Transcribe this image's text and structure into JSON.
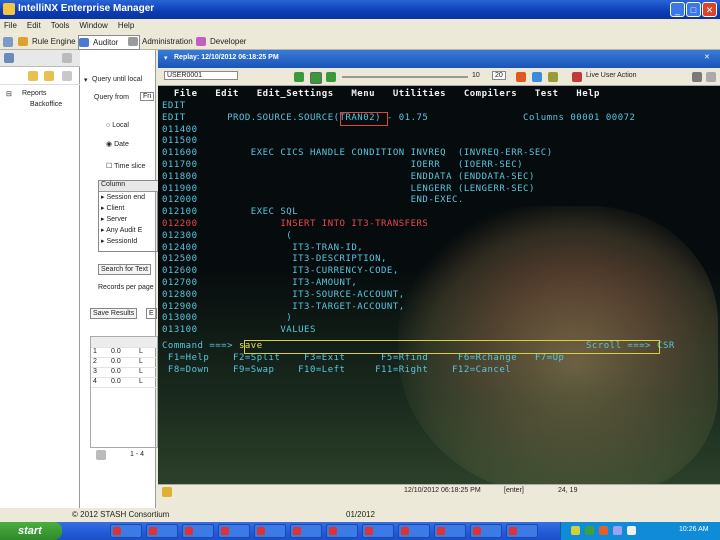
{
  "window": {
    "title": "IntelliNX Enterprise Manager",
    "minimize": "_",
    "maximize": "□",
    "close": "✕"
  },
  "menubar": [
    "File",
    "Edit",
    "Tools",
    "Window",
    "Help"
  ],
  "perspectives": [
    {
      "label": "Rule Engine",
      "icon": "rule-engine-icon"
    },
    {
      "label": "Auditor",
      "icon": "auditor-icon"
    },
    {
      "label": "Administration",
      "icon": "admin-icon"
    },
    {
      "label": "Developer",
      "icon": "developer-icon"
    }
  ],
  "tree": {
    "root": "Reports",
    "child": "Backoffice"
  },
  "query": {
    "title": "Query until local",
    "query_from": "Query from",
    "from_value": "Fri",
    "radio_local": "Local",
    "radio_date": "Date",
    "check_time": "Time slice",
    "column_header": "Column",
    "columns": [
      "Session end",
      "Client",
      "Server",
      "Any Audit E",
      "SessionId"
    ],
    "search_btn": "Search for Text",
    "records_label": "Records per page",
    "tab_save": "Save Results",
    "tab_e": "E",
    "rows": [
      {
        "n": "1",
        "v": "0.0",
        "c": "L"
      },
      {
        "n": "2",
        "v": "0.0",
        "c": "L"
      },
      {
        "n": "3",
        "v": "0.0",
        "c": "L"
      },
      {
        "n": "4",
        "v": "0.0",
        "c": "L"
      }
    ],
    "pager": "1 - 4"
  },
  "replay": {
    "tab_label": "Replay: 12/10/2012 06:18:25 PM",
    "toolbar_field": "USER0001",
    "counter_a": "10",
    "counter_b": "20",
    "live_action": "Live User Action"
  },
  "terminal": {
    "menu": "  File   Edit   Edit_Settings   Menu   Utilities   Compilers   Test   Help",
    "lines": [
      "EDIT",
      "EDIT       PROD.SOURCE.SOURCE(TRAN02) - 01.75                Columns 00001 00072",
      "011400",
      "011500",
      "011600         EXEC CICS HANDLE CONDITION INVREQ  (INVREQ-ERR-SEC)",
      "011700                                    IOERR   (IOERR-SEC)",
      "011800                                    ENDDATA (ENDDATA-SEC)",
      "011900                                    LENGERR (LENGERR-SEC)",
      "012000                                    END-EXEC.",
      "012100         EXEC SQL",
      "012200              INSERT INTO IT3-TRANSFERS",
      "012300               (",
      "012400                IT3-TRAN-ID,",
      "012500                IT3-DESCRIPTION,",
      "012600                IT3-CURRENCY-CODE,",
      "012700                IT3-AMOUNT,",
      "012800                IT3-SOURCE-ACCOUNT,",
      "012900                IT3-TARGET-ACCOUNT,",
      "013000               )",
      "013100              VALUES"
    ],
    "red_line_index": 10,
    "command_label": "Command ===>",
    "command_value": "save",
    "scroll_label": "Scroll ===> CSR",
    "pf1": " F1=Help    F2=Split    F3=Exit      F5=Rfind     F6=Rchange   F7=Up",
    "pf2": " F8=Down    F9=Swap    F10=Left     F11=Right    F12=Cancel"
  },
  "status": {
    "session": "12/10/2012 06:18:25 PM",
    "key": "[enter]",
    "pos": "24, 19"
  },
  "footer": {
    "copyright": "© 2012 STASH Consortium",
    "date": "01/2012"
  },
  "taskbar": {
    "start": "start",
    "clock": "10:26 AM"
  }
}
